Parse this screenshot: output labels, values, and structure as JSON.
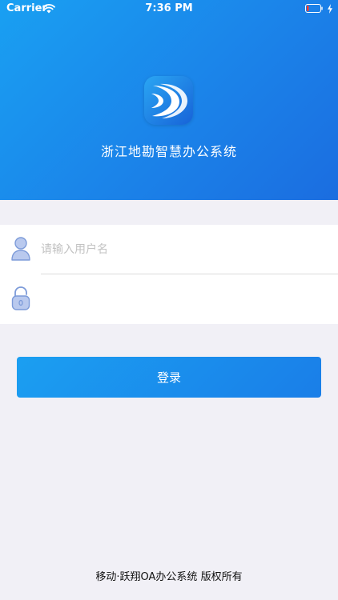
{
  "status_bar": {
    "carrier": "Carrier",
    "time": "7:36 PM",
    "icons": [
      "wifi-icon",
      "battery-icon",
      "charging-icon"
    ]
  },
  "header": {
    "app_title": "浙江地勘智慧办公系统",
    "logo_icon": "app-logo-icon"
  },
  "form": {
    "username": {
      "value": "",
      "placeholder": "请输入用户名",
      "icon": "user-icon"
    },
    "password": {
      "value": "",
      "placeholder": "",
      "icon": "lock-icon"
    }
  },
  "login_button": {
    "label": "登录"
  },
  "footer": {
    "text": "移动·跃翔OA办公系统 版权所有"
  },
  "colors": {
    "header_gradient_start": "#19a0f2",
    "header_gradient_end": "#1b6de0",
    "page_background": "#f1f0f6",
    "button_blue": "#1a8cec",
    "icon_blue": "#8aa6dd"
  }
}
